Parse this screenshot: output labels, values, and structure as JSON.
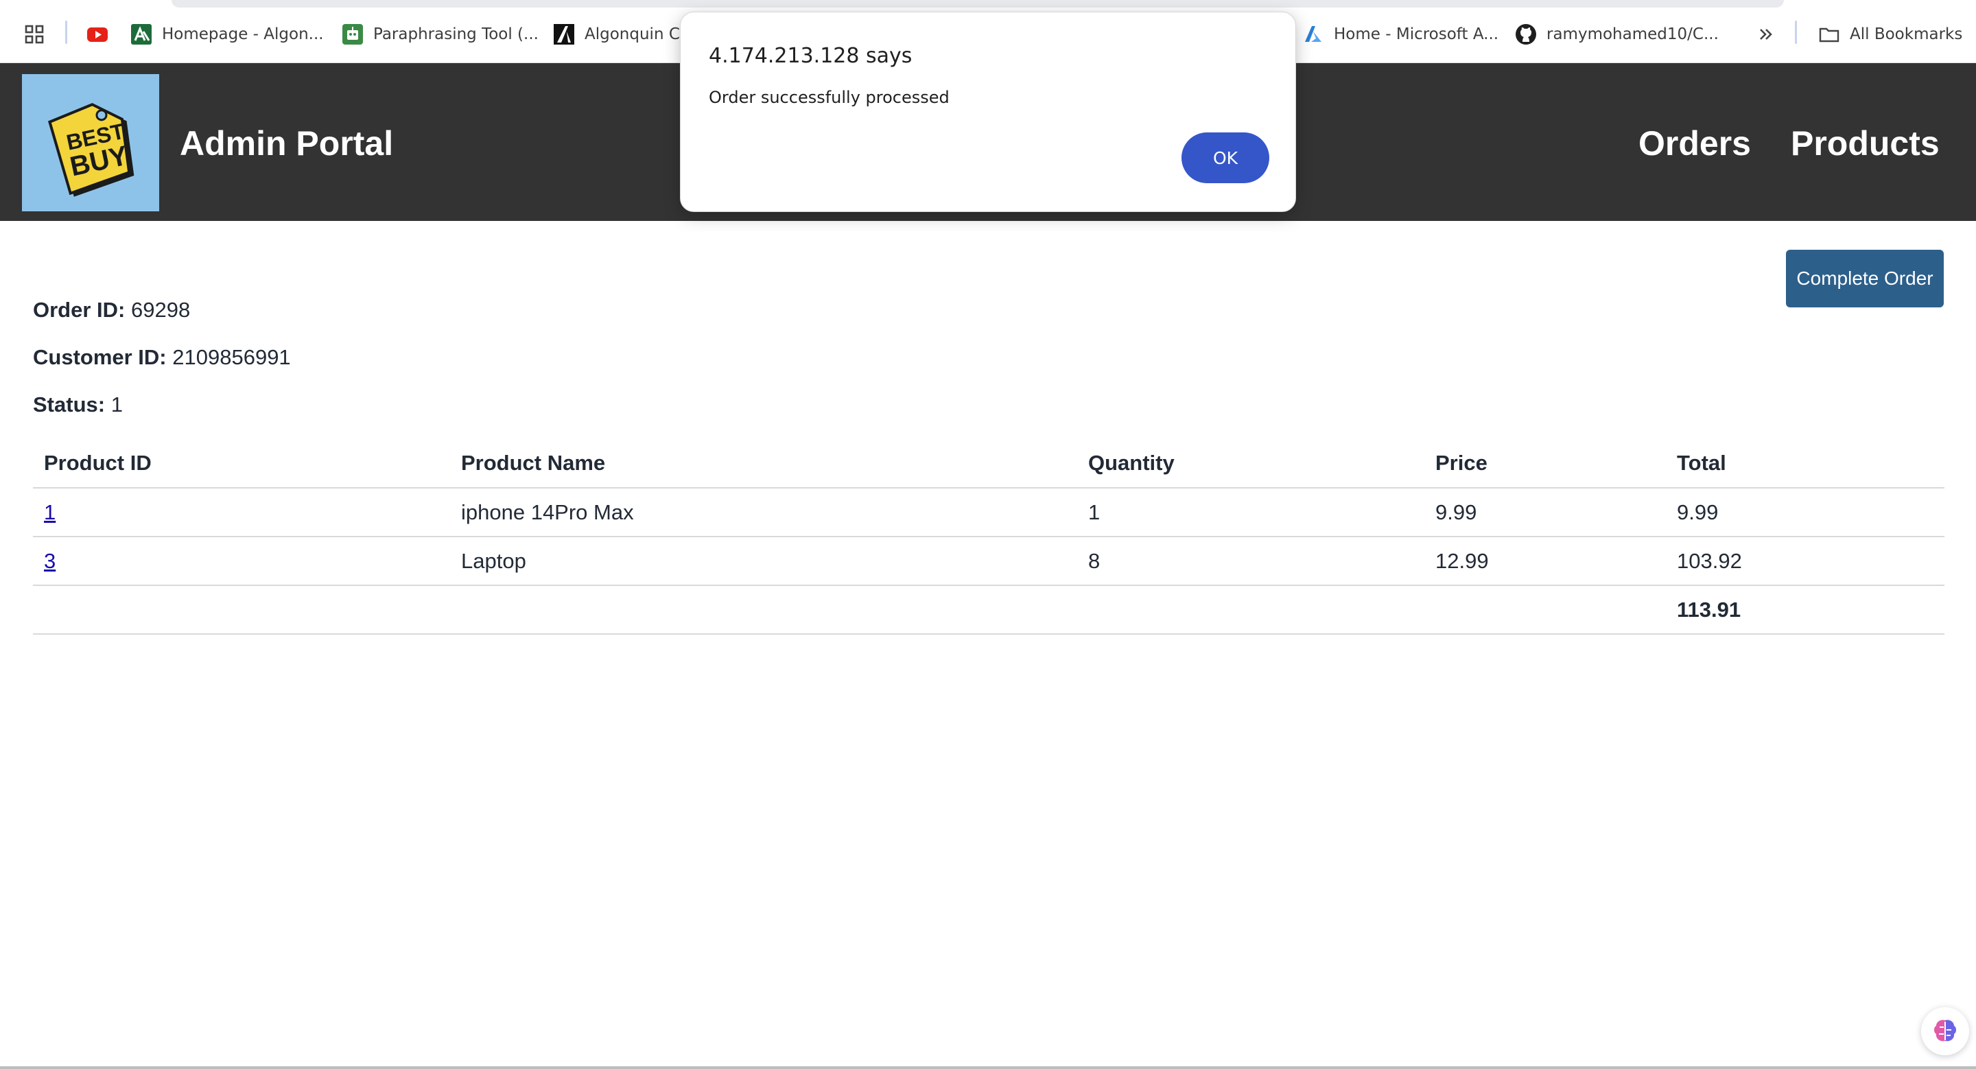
{
  "bookmarks": [
    {
      "label": "",
      "icon": "apps-grid-icon"
    },
    {
      "label": "",
      "icon": "youtube-icon"
    },
    {
      "label": "Homepage - Algon...",
      "icon": "algonquin-icon"
    },
    {
      "label": "Paraphrasing Tool (...",
      "icon": "robot-icon"
    },
    {
      "label": "Algonquin Co",
      "icon": "algonquin-a-icon"
    },
    {
      "label": "Home - Microsoft A...",
      "icon": "azure-icon"
    },
    {
      "label": "ramymohamed10/C...",
      "icon": "github-icon"
    },
    {
      "label": "",
      "icon": "chevron-double-right-icon"
    },
    {
      "label": "All Bookmarks",
      "icon": "folder-icon"
    }
  ],
  "header": {
    "logo_text_top": "BEST",
    "logo_text_bottom": "BUY",
    "title": "Admin Portal",
    "nav": [
      "Orders",
      "Products"
    ]
  },
  "dialog": {
    "title": "4.174.213.128 says",
    "message": "Order successfully processed",
    "ok_label": "OK"
  },
  "order": {
    "complete_button": "Complete Order",
    "order_id_label": "Order ID:",
    "order_id": "69298",
    "customer_id_label": "Customer ID:",
    "customer_id": "2109856991",
    "status_label": "Status:",
    "status": "1"
  },
  "table": {
    "headers": [
      "Product ID",
      "Product Name",
      "Quantity",
      "Price",
      "Total"
    ],
    "rows": [
      {
        "product_id": "1",
        "name": "iphone 14Pro Max",
        "quantity": "1",
        "price": "9.99",
        "total": "9.99"
      },
      {
        "product_id": "3",
        "name": "Laptop",
        "quantity": "8",
        "price": "12.99",
        "total": "103.92"
      }
    ],
    "grand_total": "113.91"
  },
  "colors": {
    "header_bg": "#333333",
    "logo_bg": "#8ec3e9",
    "button_bg": "#2d5f8b",
    "dialog_ok": "#3556c8",
    "link": "#1a0dab"
  }
}
